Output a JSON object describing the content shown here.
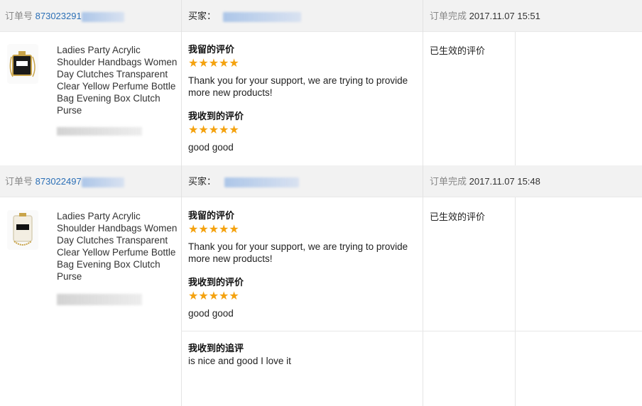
{
  "labels": {
    "order_no": "订单号",
    "buyer": "买家：",
    "completed": "订单完成",
    "my_review": "我留的评价",
    "received_review": "我收到的评价",
    "followup": "我收到的追评",
    "status": "已生效的评价"
  },
  "colors": {
    "star": "#f4a20f",
    "link": "#2b6fb6",
    "header_bg": "#f2f2f2"
  },
  "orders": [
    {
      "order_no": "873023291",
      "completed_time": "2017.11.07 15:51",
      "product_title": "Ladies Party Acrylic Shoulder Handbags Women Day Clutches Transparent Clear Yellow Perfume Bottle Bag Evening Box Clutch Purse",
      "image_icon": "black-box-clutch-image",
      "my_rating": "★★★★★",
      "my_review": "Thank you for your support, we are trying to provide more new products!",
      "received_rating": "★★★★★",
      "received_review": "good good",
      "status": "已生效的评价"
    },
    {
      "order_no": "873022497",
      "completed_time": "2017.11.07 15:48",
      "product_title": "Ladies Party Acrylic Shoulder Handbags Women Day Clutches Transparent Clear Yellow Perfume Bottle Bag Evening Box Clutch Purse",
      "image_icon": "clear-perfume-clutch-image",
      "my_rating": "★★★★★",
      "my_review": "Thank you for your support, we are trying to provide more new products!",
      "received_rating": "★★★★★",
      "received_review": "good good",
      "followup_review": "is nice and good I love it",
      "status": "已生效的评价"
    }
  ]
}
